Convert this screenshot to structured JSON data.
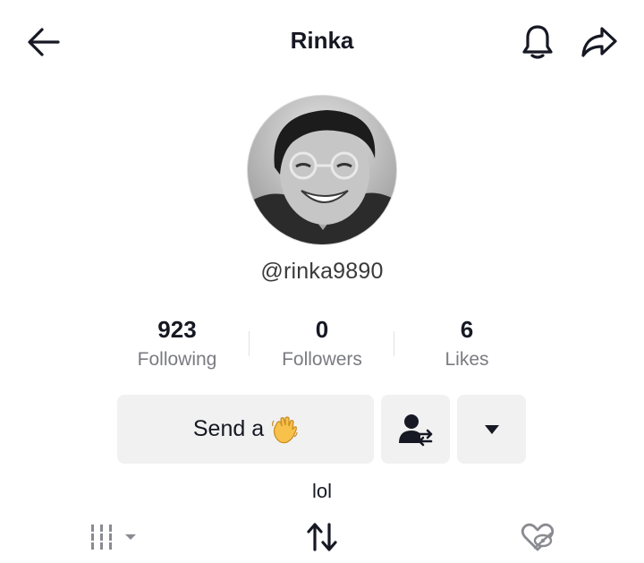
{
  "header": {
    "title": "Rinka",
    "back_icon": "arrow-left-icon",
    "bell_icon": "bell-icon",
    "share_icon": "share-icon"
  },
  "profile": {
    "username": "@rinka9890",
    "bio": "lol"
  },
  "stats": [
    {
      "value": "923",
      "label": "Following"
    },
    {
      "value": "0",
      "label": "Followers"
    },
    {
      "value": "6",
      "label": "Likes"
    }
  ],
  "actions": {
    "wave_label": "Send a",
    "wave_icon": "waving-hand-icon",
    "follow_icon": "follow-back-icon",
    "more_icon": "triangle-down-icon"
  },
  "tabs": {
    "grid_icon": "video-grid-icon",
    "repost_icon": "repost-icon",
    "liked_icon": "liked-hidden-icon"
  },
  "colors": {
    "text_primary": "#161823",
    "text_secondary": "#7a7b80",
    "button_bg": "#f1f1f2",
    "wave_yellow": "#f7c14b"
  }
}
